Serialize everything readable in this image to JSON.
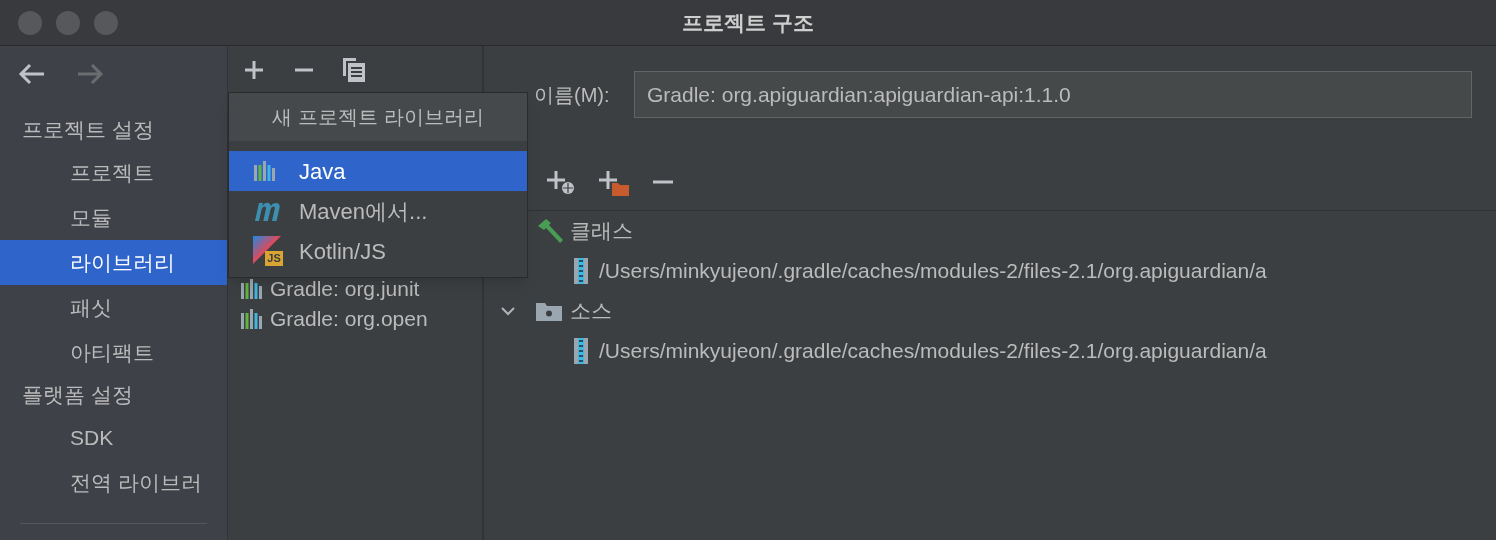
{
  "window": {
    "title": "프로젝트 구조"
  },
  "nav": {
    "back": {
      "disabled": false
    },
    "forward": {
      "disabled": true
    }
  },
  "sidebar": {
    "sections": [
      {
        "label": "프로젝트 설정",
        "items": [
          {
            "label": "프로젝트",
            "selected": false
          },
          {
            "label": "모듈",
            "selected": false
          },
          {
            "label": "라이브러리",
            "selected": true
          },
          {
            "label": "패싯",
            "selected": false
          },
          {
            "label": "아티팩트",
            "selected": false
          }
        ]
      },
      {
        "label": "플랫폼 설정",
        "items": [
          {
            "label": "SDK",
            "selected": false
          },
          {
            "label": "전역 라이브러",
            "selected": false
          }
        ]
      }
    ]
  },
  "libraries": [
    {
      "label": "Gradle: org.junit"
    },
    {
      "label": "Gradle: org.open"
    }
  ],
  "popup": {
    "title": "새 프로젝트 라이브러리",
    "items": [
      {
        "kind": "java",
        "label": "Java",
        "selected": true
      },
      {
        "kind": "maven",
        "label": "Maven에서...",
        "selected": false
      },
      {
        "kind": "kotlin-js",
        "label": "Kotlin/JS",
        "badge": "JS",
        "selected": false
      }
    ]
  },
  "details": {
    "name_label": "이름(M):",
    "name_value": "Gradle: org.apiguardian:apiguardian-api:1.1.0",
    "roots": [
      {
        "kind": "classes",
        "label": "클래스",
        "children": [
          {
            "label": "/Users/minkyujeon/.gradle/caches/modules-2/files-2.1/org.apiguardian/a"
          }
        ]
      },
      {
        "kind": "sources",
        "label": "소스",
        "expanded": true,
        "children": [
          {
            "label": "/Users/minkyujeon/.gradle/caches/modules-2/files-2.1/org.apiguardian/a"
          }
        ]
      }
    ]
  }
}
